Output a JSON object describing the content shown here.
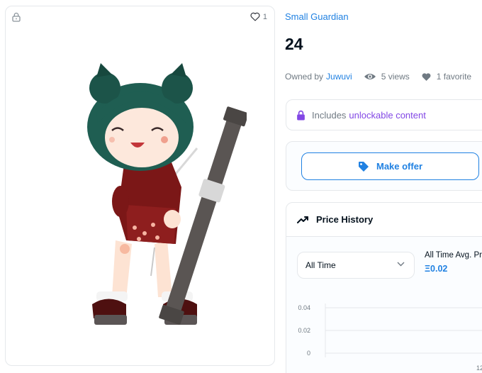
{
  "media": {
    "favorite_count": "1",
    "lock_icon": "lock-icon",
    "heart_icon": "heart-outline-icon"
  },
  "item": {
    "collection": "Small Guardian",
    "title": "24",
    "owned_by_label": "Owned by",
    "owner": "Juwuvi",
    "views": "5 views",
    "favorites": "1 favorite"
  },
  "unlockable": {
    "prefix": "Includes",
    "accent": "unlockable content"
  },
  "offer": {
    "button_label": "Make offer",
    "icon": "tag-icon"
  },
  "price_history": {
    "title": "Price History",
    "range_selected": "All Time",
    "avg_label": "All Time Avg. Price",
    "avg_value": "Ξ0.02"
  },
  "chart_data": {
    "type": "line",
    "title": "",
    "xlabel": "",
    "ylabel": "",
    "ylim": [
      0,
      0.04
    ],
    "yticks": [
      "0.04",
      "0.02",
      "0"
    ],
    "xticks": [
      "12"
    ],
    "series": []
  },
  "colors": {
    "accent_blue": "#2081e2",
    "accent_purple": "#8247e5",
    "border": "#e5e8eb",
    "muted_text": "#707a83"
  }
}
